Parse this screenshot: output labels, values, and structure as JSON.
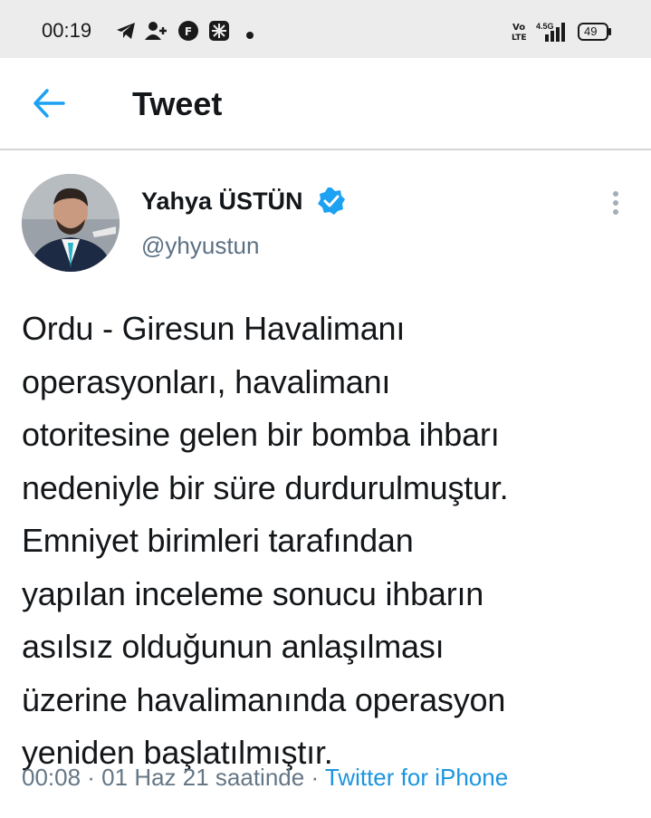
{
  "status_bar": {
    "time": "00:19",
    "network": "4.5G",
    "volte": "Vo LTE",
    "battery": "49",
    "icons": [
      "telegram-icon",
      "person-add-icon",
      "fl-app-icon",
      "app-icon",
      "notification-dot-icon",
      "volte-icon",
      "signal-icon",
      "battery-icon"
    ]
  },
  "header": {
    "title": "Tweet",
    "back_icon": "arrow-left-icon"
  },
  "tweet": {
    "author_name": "Yahya ÜSTÜN",
    "handle": "@yhyustun",
    "verified_icon": "verified-badge-icon",
    "more_icon": "more-vertical-icon",
    "text_lines": [
      "Ordu - Giresun Havalimanı",
      "operasyonları, havalimanı",
      "otoritesine gelen bir bomba ihbarı",
      "nedeniyle bir süre durdurulmuştur.",
      "Emniyet birimleri tarafından",
      "yapılan inceleme sonucu ihbarın",
      "asılsız olduğunun anlaşılması",
      "üzerine havalimanında operasyon",
      "yeniden başlatılmıştır."
    ],
    "meta": "00:08 · 01 Haz 21 saatinde · ",
    "source": "Twitter for iPhone"
  },
  "colors": {
    "accent": "#1da1f2",
    "text": "#14171a",
    "secondary": "#5b7083",
    "status_bar_bg": "#ececec"
  }
}
